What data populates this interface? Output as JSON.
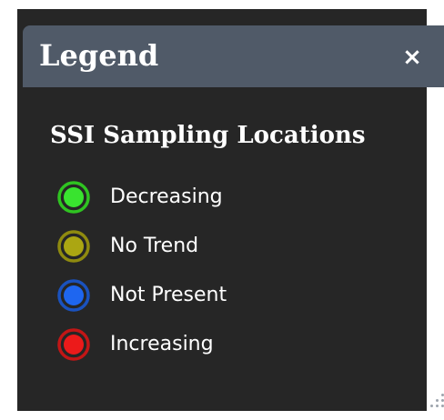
{
  "legend_panel": {
    "title": "Legend",
    "close_label": "×",
    "section_title": "SSI Sampling Locations",
    "items": [
      {
        "label": "Decreasing",
        "color": "#39e32f",
        "ring_color": "#2fc321"
      },
      {
        "label": "No Trend",
        "color": "#aba612",
        "ring_color": "#8f8a0f"
      },
      {
        "label": "Not Present",
        "color": "#1e66f0",
        "ring_color": "#1a52be"
      },
      {
        "label": "Increasing",
        "color": "#ec1a1a",
        "ring_color": "#c21616"
      }
    ]
  },
  "colors": {
    "panel_background": "#262626",
    "header_background": "#505a68",
    "text": "#ffffff"
  },
  "icons": {
    "close": "close-icon",
    "resize": "resize-handle-icon"
  }
}
